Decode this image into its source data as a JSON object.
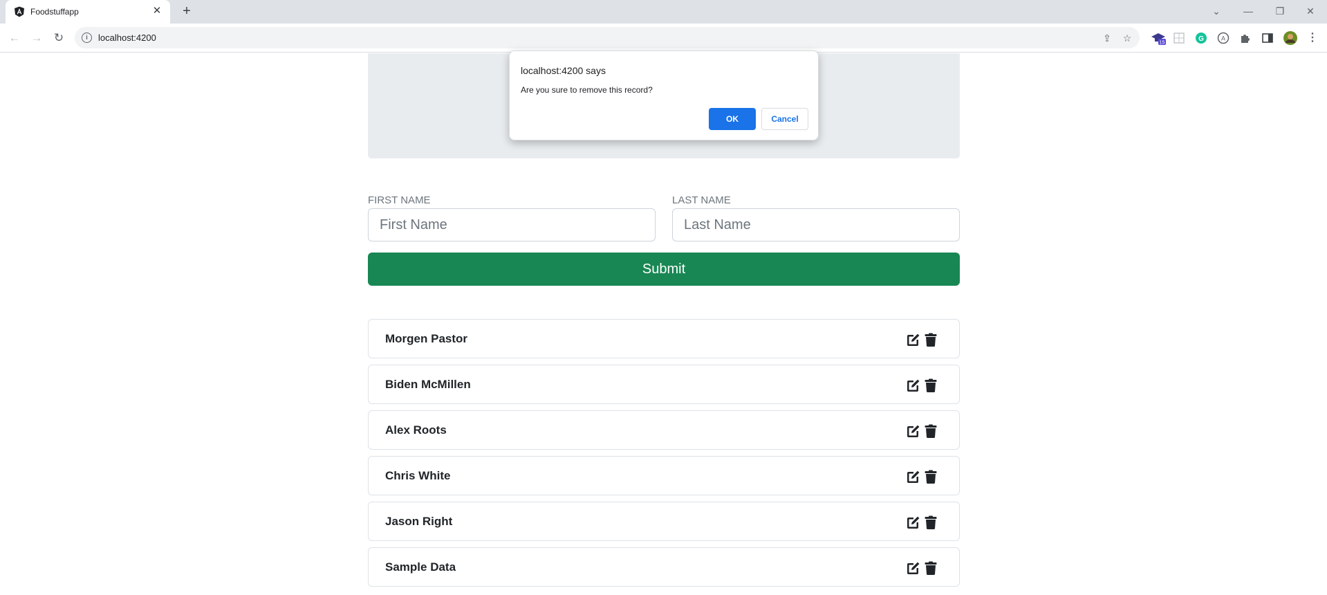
{
  "browser": {
    "tab_title": "Foodstuffapp",
    "tab_close": "✕",
    "new_tab": "+",
    "url": "localhost:4200",
    "controls": {
      "tab_search": "⌄",
      "minimize": "—",
      "restore": "❐",
      "close": "✕"
    },
    "extension_badge": "15",
    "icons": [
      "share-icon",
      "bookmark-star-icon",
      "extension-icon",
      "puzzle-icon",
      "side-panel-icon",
      "profile-avatar",
      "menu-icon"
    ]
  },
  "dialog": {
    "title": "localhost:4200 says",
    "message": "Are you sure to remove this record?",
    "ok_label": "OK",
    "cancel_label": "Cancel"
  },
  "form": {
    "first_name_label": "FIRST NAME",
    "first_name_placeholder": "First Name",
    "first_name_value": "",
    "last_name_label": "LAST NAME",
    "last_name_placeholder": "Last Name",
    "last_name_value": "",
    "submit_label": "Submit",
    "submit_color": "#198754"
  },
  "records": [
    {
      "name": "Morgen Pastor"
    },
    {
      "name": "Biden McMillen"
    },
    {
      "name": "Alex Roots"
    },
    {
      "name": "Chris White"
    },
    {
      "name": "Jason Right"
    },
    {
      "name": "Sample Data"
    }
  ],
  "colors": {
    "accent": "#1a73e8",
    "jumbotron": "#e9ecef"
  }
}
